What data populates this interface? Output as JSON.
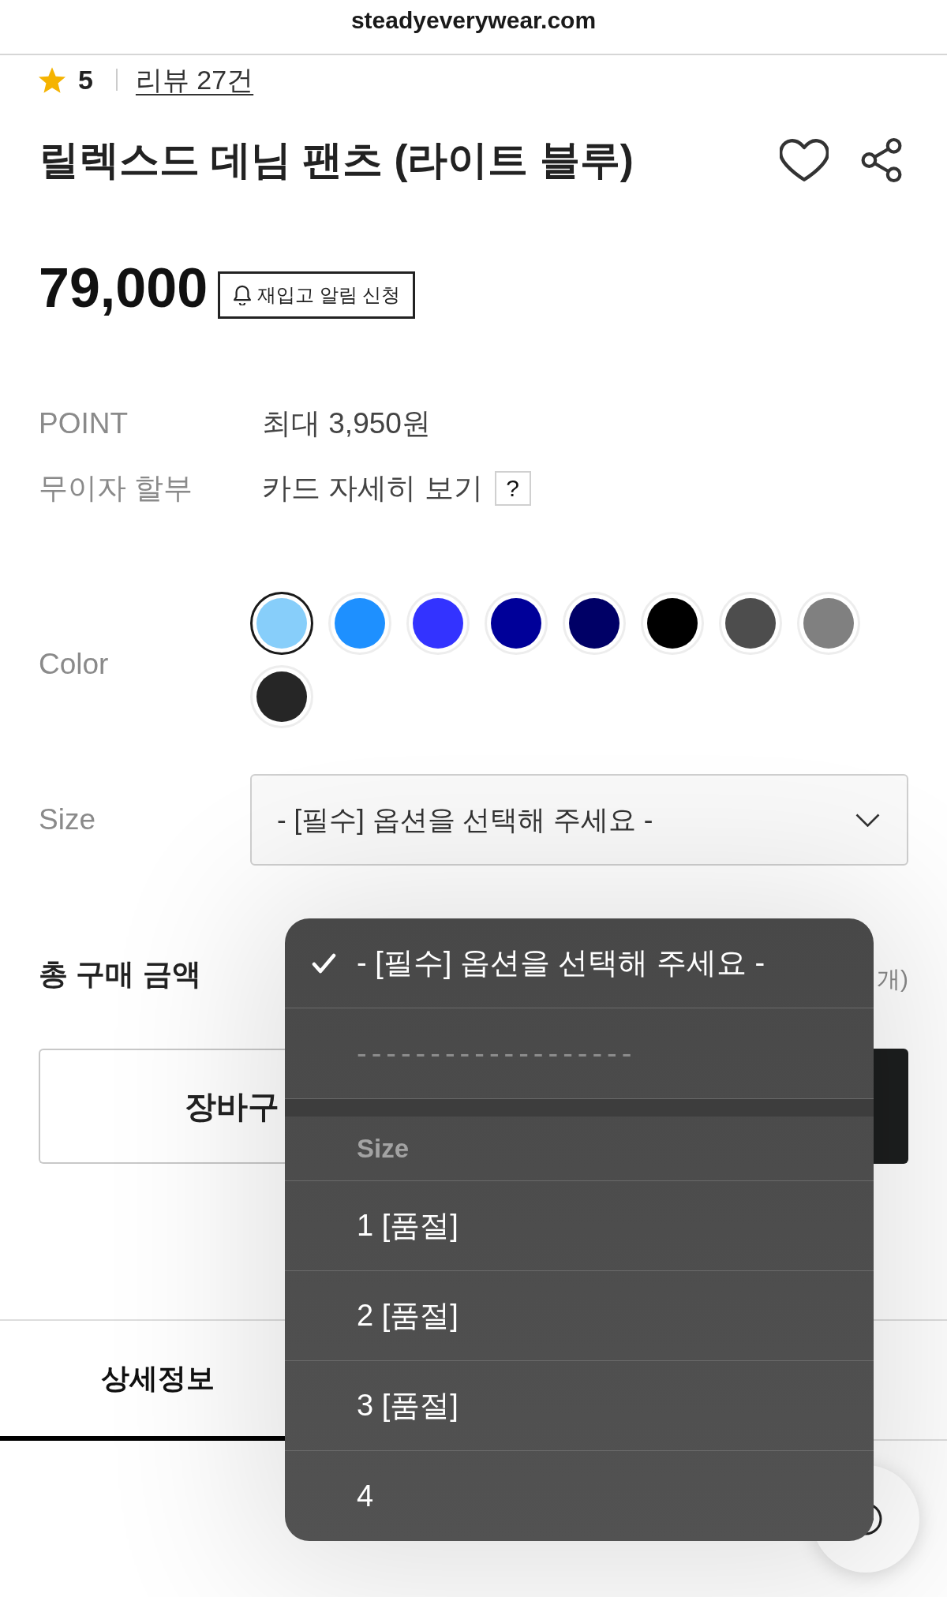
{
  "browser": {
    "url": "steadyeverywear.com"
  },
  "rating": {
    "score": "5",
    "reviews": "리뷰 27건"
  },
  "product": {
    "title": "릴렉스드 데님 팬츠 (라이트 블루)",
    "price": "79,000",
    "restock_button": "재입고 알림 신청"
  },
  "info_rows": [
    {
      "label": "POINT",
      "value": "최대 3,950원"
    },
    {
      "label": "무이자 할부",
      "value": "카드 자세히 보기",
      "help": "?"
    }
  ],
  "color_option": {
    "label": "Color",
    "swatches": [
      {
        "color": "#87cefa",
        "selected": true
      },
      {
        "color": "#1e90ff",
        "selected": false
      },
      {
        "color": "#3333ff",
        "selected": false
      },
      {
        "color": "#000099",
        "selected": false
      },
      {
        "color": "#000066",
        "selected": false
      },
      {
        "color": "#000000",
        "selected": false
      },
      {
        "color": "#4d4d4d",
        "selected": false
      },
      {
        "color": "#808080",
        "selected": false
      },
      {
        "color": "#262626",
        "selected": false
      }
    ]
  },
  "size_option": {
    "label": "Size",
    "value": "- [필수] 옵션을 선택해 주세요 -"
  },
  "total": {
    "label": "총 구매 금액",
    "count": "개)"
  },
  "buttons": [
    {
      "kind": "outline",
      "label": "장바구"
    },
    {
      "kind": "solid"
    }
  ],
  "tabs": [
    {
      "label": "상세정보",
      "selected": true
    }
  ],
  "dropdown": {
    "items": [
      {
        "kind": "option",
        "label": "- [필수] 옵션을 선택해 주세요 -",
        "selected": true
      },
      {
        "kind": "separator",
        "label": "-------------------"
      },
      {
        "kind": "group",
        "label": "Size"
      },
      {
        "kind": "option",
        "label": "1 [품절]",
        "selected": false
      },
      {
        "kind": "option",
        "label": "2 [품절]",
        "selected": false
      },
      {
        "kind": "option",
        "label": "3 [품절]",
        "selected": false
      },
      {
        "kind": "option",
        "label": "4",
        "selected": false
      }
    ]
  }
}
